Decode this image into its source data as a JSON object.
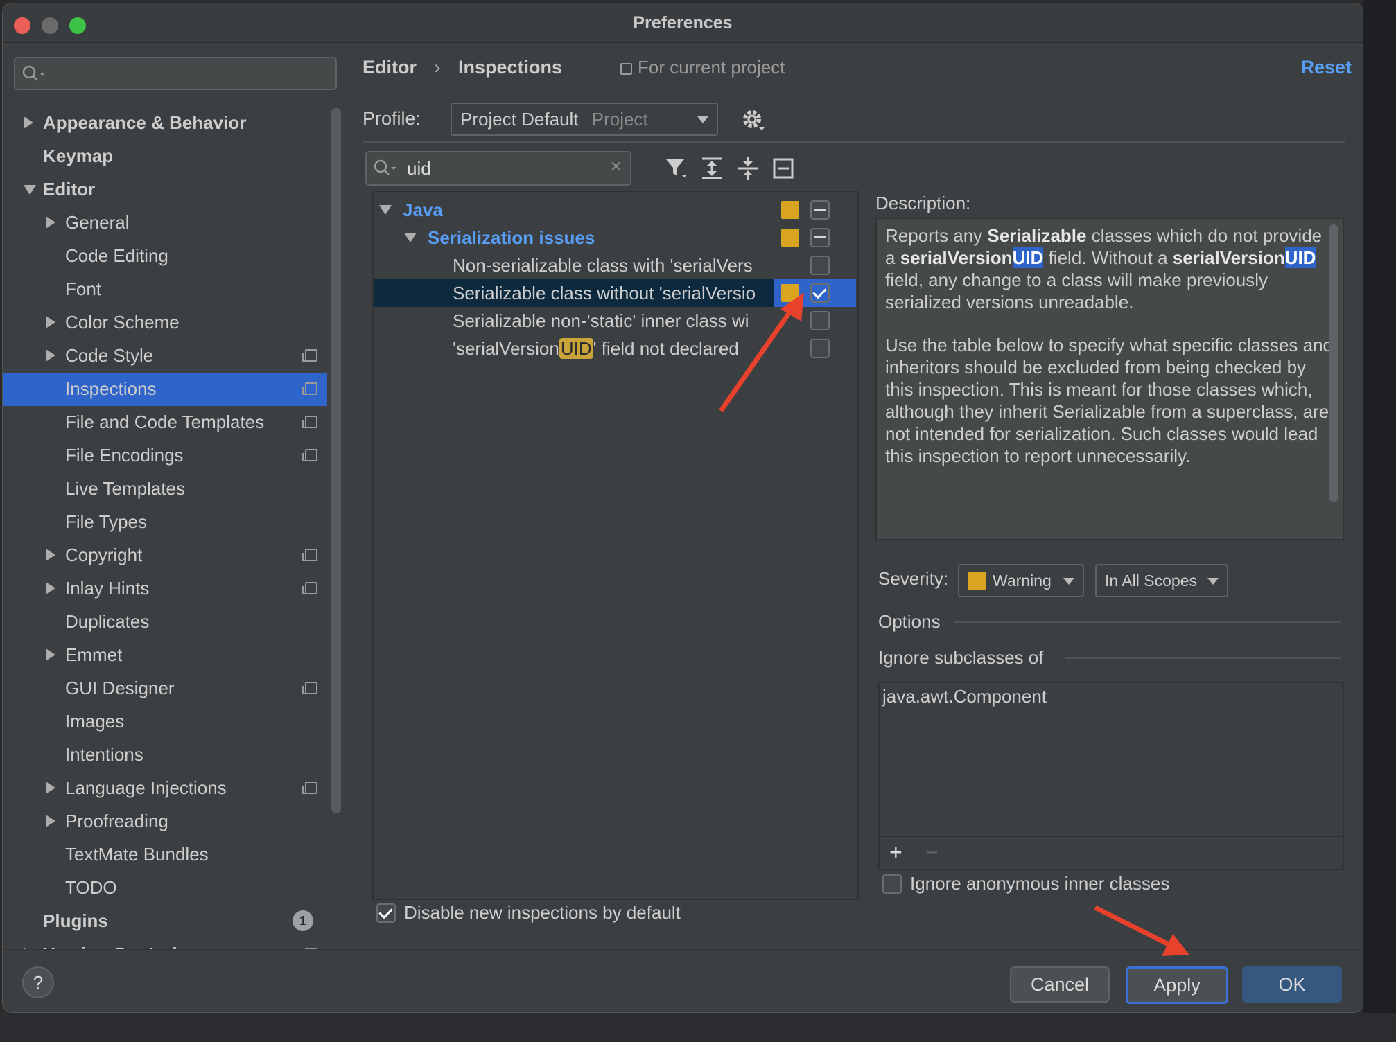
{
  "window": {
    "title": "Preferences"
  },
  "sidebar": {
    "search_placeholder": "",
    "items": [
      {
        "label": "Appearance & Behavior",
        "level": 0,
        "expander": "right",
        "bold": true
      },
      {
        "label": "Keymap",
        "level": 0,
        "expander": "none",
        "bold": true
      },
      {
        "label": "Editor",
        "level": 0,
        "expander": "down",
        "bold": true
      },
      {
        "label": "General",
        "level": 1,
        "expander": "right"
      },
      {
        "label": "Code Editing",
        "level": 1,
        "expander": "none"
      },
      {
        "label": "Font",
        "level": 1,
        "expander": "none"
      },
      {
        "label": "Color Scheme",
        "level": 1,
        "expander": "right"
      },
      {
        "label": "Code Style",
        "level": 1,
        "expander": "right",
        "project_icon": true
      },
      {
        "label": "Inspections",
        "level": 1,
        "expander": "none",
        "project_icon": true,
        "selected": true
      },
      {
        "label": "File and Code Templates",
        "level": 1,
        "expander": "none",
        "project_icon": true
      },
      {
        "label": "File Encodings",
        "level": 1,
        "expander": "none",
        "project_icon": true
      },
      {
        "label": "Live Templates",
        "level": 1,
        "expander": "none"
      },
      {
        "label": "File Types",
        "level": 1,
        "expander": "none"
      },
      {
        "label": "Copyright",
        "level": 1,
        "expander": "right",
        "project_icon": true
      },
      {
        "label": "Inlay Hints",
        "level": 1,
        "expander": "right",
        "project_icon": true
      },
      {
        "label": "Duplicates",
        "level": 1,
        "expander": "none"
      },
      {
        "label": "Emmet",
        "level": 1,
        "expander": "right"
      },
      {
        "label": "GUI Designer",
        "level": 1,
        "expander": "none",
        "project_icon": true
      },
      {
        "label": "Images",
        "level": 1,
        "expander": "none"
      },
      {
        "label": "Intentions",
        "level": 1,
        "expander": "none"
      },
      {
        "label": "Language Injections",
        "level": 1,
        "expander": "right",
        "project_icon": true
      },
      {
        "label": "Proofreading",
        "level": 1,
        "expander": "right"
      },
      {
        "label": "TextMate Bundles",
        "level": 1,
        "expander": "none"
      },
      {
        "label": "TODO",
        "level": 1,
        "expander": "none"
      },
      {
        "label": "Plugins",
        "level": 0,
        "expander": "none",
        "bold": true,
        "badge": "1"
      },
      {
        "label": "Version Control",
        "level": 0,
        "expander": "right",
        "bold": true,
        "project_icon": true
      }
    ]
  },
  "header": {
    "crumb1": "Editor",
    "crumb_sep": "›",
    "crumb2": "Inspections",
    "scope_note": "For current project",
    "reset": "Reset"
  },
  "profile": {
    "label": "Profile:",
    "name": "Project Default",
    "kind": "Project"
  },
  "filter": {
    "value": "uid"
  },
  "inspections": {
    "group": "Java",
    "subgroup": "Serialization issues",
    "rows": [
      {
        "text": "Non-serializable class with 'serialVers",
        "severity": false,
        "checked": false
      },
      {
        "text": "Serializable class without 'serialVersio",
        "severity": true,
        "checked": true,
        "selected": true
      },
      {
        "text": "Serializable non-'static' inner class wi",
        "severity": false,
        "checked": false
      },
      {
        "pre": "'serialVersion",
        "hl": "UID",
        "post": "' field not declared",
        "severity": false,
        "checked": false
      }
    ]
  },
  "disable_new": {
    "label": "Disable new inspections by default",
    "checked": true
  },
  "description": {
    "label": "Description:",
    "p1_a": "Reports any ",
    "p1_b": "Serializable",
    "p1_c": " classes which do not provide a ",
    "p1_d": "serialVersion",
    "p1_e": "UID",
    "p1_f": " field. Without a ",
    "p1_g": "serialVersion",
    "p1_h": "UID",
    "p1_i": " field, any change to a class will make previously serialized versions unreadable.",
    "p2": "Use the table below to specify what specific classes and inheritors should be excluded from being checked by this inspection. This is meant for those classes which, although they inherit Serializable from a superclass, are not intended for serialization. Such classes would lead this inspection to report unnecessarily."
  },
  "severity": {
    "label": "Severity:",
    "value": "Warning",
    "scope": "In All Scopes",
    "color": "#d9a420"
  },
  "options": {
    "title": "Options",
    "ignore_subclasses_label": "Ignore subclasses of",
    "list_items": [
      "java.awt.Component"
    ],
    "add": "+",
    "remove": "−",
    "ignore_anonymous": "Ignore anonymous inner classes"
  },
  "footer": {
    "help": "?",
    "cancel": "Cancel",
    "apply": "Apply",
    "ok": "OK"
  },
  "colors": {
    "accent": "#2f65ca",
    "link": "#589df6",
    "annotation": "#e8412c"
  }
}
